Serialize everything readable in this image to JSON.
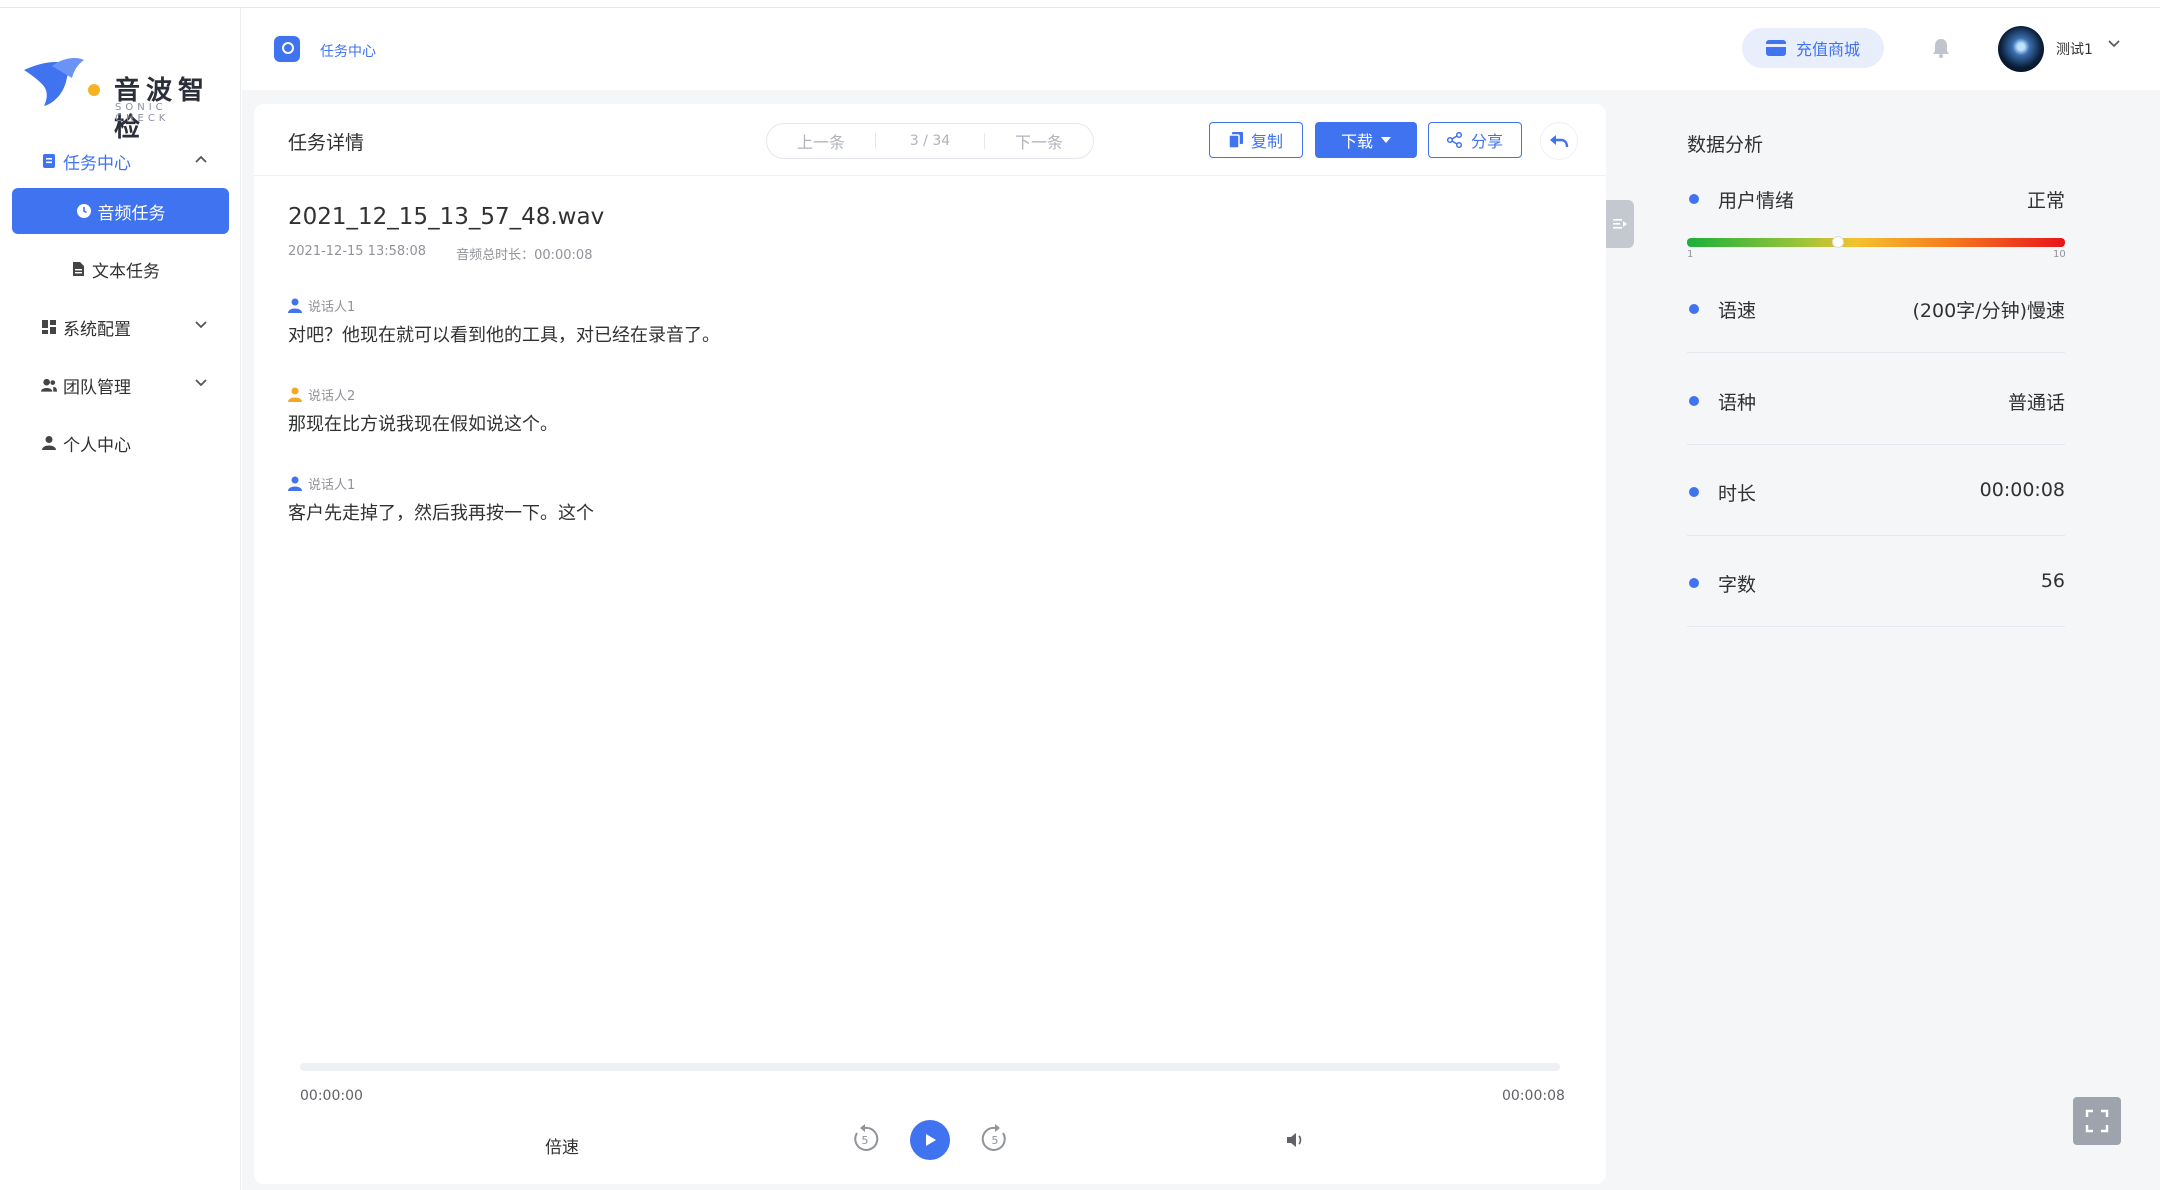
{
  "brand": {
    "name": "音波智检",
    "sub": "SONIC CHECK"
  },
  "sidebar": {
    "items": [
      {
        "label": "任务中心"
      },
      {
        "label": "音频任务"
      },
      {
        "label": "文本任务"
      },
      {
        "label": "系统配置"
      },
      {
        "label": "团队管理"
      },
      {
        "label": "个人中心"
      }
    ]
  },
  "header": {
    "breadcrumb": "任务中心",
    "recharge_label": "充值商城",
    "username": "测试1"
  },
  "task": {
    "title": "任务详情",
    "prev_label": "上一条",
    "page_indicator": "3 / 34",
    "next_label": "下一条",
    "copy_label": "复制",
    "download_label": "下载",
    "share_label": "分享",
    "file_name": "2021_12_15_13_57_48.wav",
    "created": "2021-12-15 13:58:08",
    "duration_text": "音频总时长：00:00:08",
    "segments": [
      {
        "speaker": "说话人1",
        "text": "对吧？他现在就可以看到他的工具，对已经在录音了。"
      },
      {
        "speaker": "说话人2",
        "text": "那现在比方说我现在假如说这个。"
      },
      {
        "speaker": "说话人1",
        "text": "客户先走掉了，然后我再按一下。这个"
      }
    ]
  },
  "player": {
    "current_time": "00:00:00",
    "total_time": "00:00:08",
    "speed_label": "倍速",
    "progress": 0,
    "skip_back_label": "5",
    "skip_forward_label": "5"
  },
  "analysis": {
    "title": "数据分析",
    "emotion": {
      "label": "用户情绪",
      "value": "正常",
      "min": "1",
      "max": "10",
      "level": 0.4
    },
    "rows": [
      {
        "label": "语速",
        "value": "(200字/分钟)慢速"
      },
      {
        "label": "语种",
        "value": "普通话"
      },
      {
        "label": "时长",
        "value": "00:00:08"
      },
      {
        "label": "字数",
        "value": "56"
      }
    ]
  },
  "colors": {
    "accent": "#3f73f0",
    "speaker2": "#f5a623"
  }
}
